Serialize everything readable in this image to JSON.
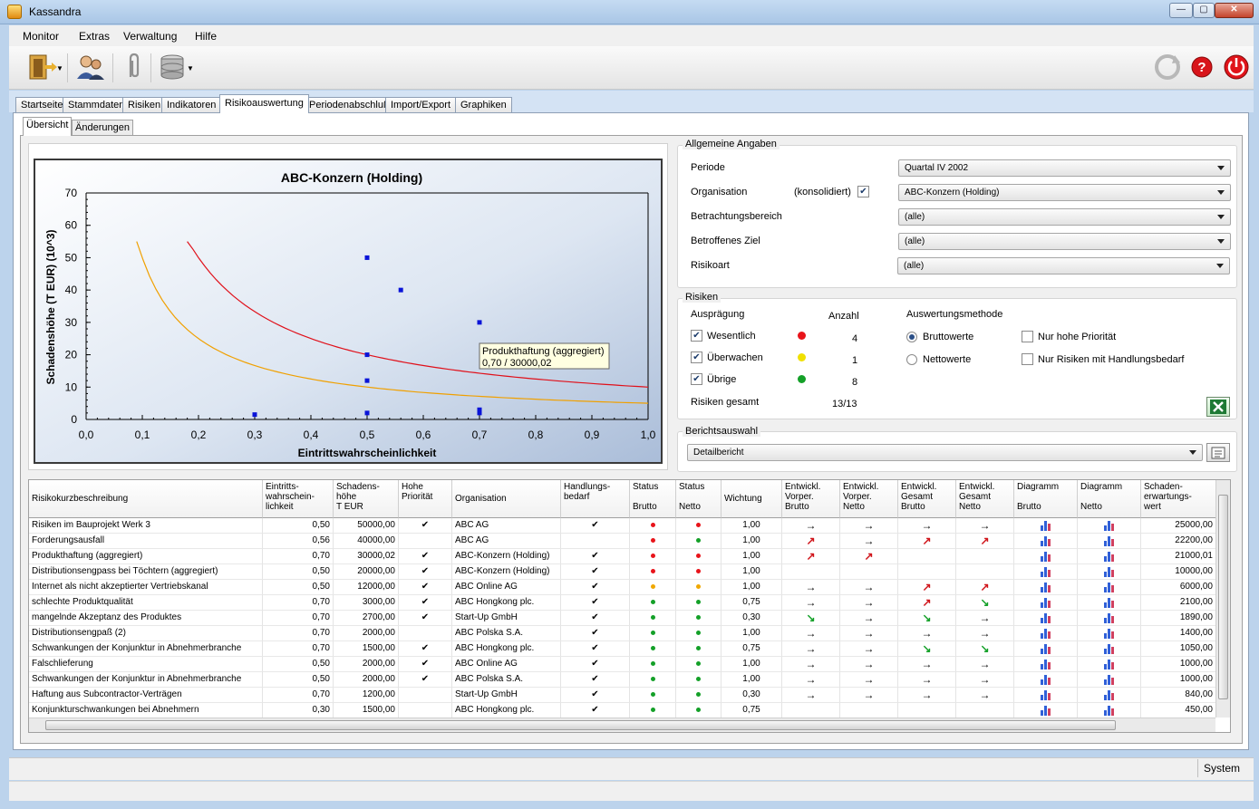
{
  "window": {
    "title": "Kassandra",
    "controls": [
      "—",
      "▢",
      "✕"
    ]
  },
  "menu": [
    "Monitor",
    "Extras",
    "Verwaltung",
    "Hilfe"
  ],
  "toolbar": {
    "left_icons": [
      "exit-door-icon",
      "users-icon",
      "paperclip-icon",
      "database-icon"
    ],
    "right_icons": [
      "refresh-icon",
      "help-icon",
      "power-icon"
    ]
  },
  "tabs": [
    "Startseite",
    "Stammdaten",
    "Risiken",
    "Indikatoren",
    "Risikoauswertung",
    "Periodenabschluß",
    "Import/Export",
    "Graphiken"
  ],
  "active_tab": "Risikoauswertung",
  "subtabs": [
    "Übersicht",
    "Änderungen"
  ],
  "active_subtab": "Übersicht",
  "chart_data": {
    "type": "scatter",
    "title": "ABC-Konzern (Holding)",
    "xlabel": "Eintrittswahrscheinlichkeit",
    "ylabel": "Schadenshöhe (T EUR)   (10^3)",
    "xlim": [
      0.0,
      1.0
    ],
    "ylim": [
      0,
      70
    ],
    "xticks": [
      "0,0",
      "0,1",
      "0,2",
      "0,3",
      "0,4",
      "0,5",
      "0,6",
      "0,7",
      "0,8",
      "0,9",
      "1,0"
    ],
    "yticks": [
      "0",
      "10",
      "20",
      "30",
      "40",
      "50",
      "60",
      "70"
    ],
    "points": [
      [
        0.5,
        50
      ],
      [
        0.56,
        40
      ],
      [
        0.7,
        30
      ],
      [
        0.5,
        20
      ],
      [
        0.5,
        12
      ],
      [
        0.3,
        1.5
      ],
      [
        0.5,
        2
      ],
      [
        0.7,
        3
      ],
      [
        0.7,
        2.7
      ],
      [
        0.7,
        2
      ]
    ],
    "curves": [
      {
        "color": "#e0101a",
        "k": 10,
        "x": [
          0.18,
          1.0
        ]
      },
      {
        "color": "#f0a000",
        "k": 5,
        "x": [
          0.09,
          1.0
        ]
      }
    ],
    "tooltip": {
      "line1": "Produkthaftung (aggregiert)",
      "line2": "0,70 / 30000,02"
    },
    "grid": false
  },
  "allgemein": {
    "title": "Allgemeine Angaben",
    "periode_label": "Periode",
    "periode_value": "Quartal IV 2002",
    "organisation_label": "Organisation",
    "konsolidiert_label": "(konsolidiert)",
    "organisation_value": "ABC-Konzern (Holding)",
    "betrachtung_label": "Betrachtungsbereich",
    "betrachtung_value": "(alle)",
    "ziel_label": "Betroffenes Ziel",
    "ziel_value": "(alle)",
    "risikoart_label": "Risikoart",
    "risikoart_value": "(alle)"
  },
  "risiken": {
    "title": "Risiken",
    "auspraegung": "Ausprägung",
    "anzahl": "Anzahl",
    "methode": "Auswertungsmethode",
    "wesentlich": "Wesentlich",
    "wesentlich_n": "4",
    "ueberwachen": "Überwachen",
    "ueberwachen_n": "1",
    "uebrige": "Übrige",
    "uebrige_n": "8",
    "gesamt_label": "Risiken gesamt",
    "gesamt_value": "13/13",
    "brutto": "Bruttowerte",
    "netto": "Nettowerte",
    "hohe_prio": "Nur hohe Priorität",
    "handlungsbedarf": "Nur Risiken mit Handlungsbedarf",
    "colors": {
      "wesentlich": "#e8141a",
      "ueberwachen": "#f0e000",
      "uebrige": "#14a028"
    }
  },
  "bericht": {
    "title": "Berichtsauswahl",
    "value": "Detailbericht"
  },
  "table": {
    "headers": [
      "Risikokurzbeschreibung",
      "Eintritts-\nwahrschein-\nlichkeit",
      "Schadens-\nhöhe\nT  EUR",
      "Hohe\nPriorität",
      "Organisation",
      "Handlungs-\nbedarf",
      "Status\n\nBrutto",
      "Status\n\nNetto",
      "Wichtung",
      "Entwickl.\nVorper.\nBrutto",
      "Entwickl.\nVorper.\nNetto",
      "Entwickl.\nGesamt\nBrutto",
      "Entwickl.\nGesamt\nNetto",
      "Diagramm\n\nBrutto",
      "Diagramm\n\nNetto",
      "Schaden-\nerwartungs-\nwert"
    ],
    "rows": [
      [
        "Risiken im Bauprojekt Werk 3",
        "0,50",
        "50000,00",
        "✔",
        "ABC AG",
        "✔",
        "r",
        "r",
        "1,00",
        "→",
        "→",
        "→",
        "→",
        "25000,00"
      ],
      [
        "Forderungsausfall",
        "0,56",
        "40000,00",
        "",
        "ABC AG",
        "",
        "r",
        "g",
        "1,00",
        "↗",
        "→",
        "↗",
        "↗",
        "22200,00"
      ],
      [
        "Produkthaftung (aggregiert)",
        "0,70",
        "30000,02",
        "✔",
        "ABC-Konzern (Holding)",
        "✔",
        "r",
        "r",
        "1,00",
        "↗",
        "↗",
        "",
        "",
        "21000,01"
      ],
      [
        "Distributionsengpass bei Töchtern (aggregiert)",
        "0,50",
        "20000,00",
        "✔",
        "ABC-Konzern (Holding)",
        "✔",
        "r",
        "r",
        "1,00",
        "",
        "",
        "",
        "",
        "10000,00"
      ],
      [
        "Internet als  nicht akzeptierter Vertriebskanal",
        "0,50",
        "12000,00",
        "✔",
        "ABC Online AG",
        "✔",
        "o",
        "o",
        "1,00",
        "→",
        "→",
        "↗",
        "↗",
        "6000,00"
      ],
      [
        "schlechte Produktqualität",
        "0,70",
        "3000,00",
        "✔",
        "ABC Hongkong plc.",
        "✔",
        "g",
        "g",
        "0,75",
        "→",
        "→",
        "↗",
        "↘",
        "2100,00"
      ],
      [
        "mangelnde Akzeptanz des Produktes",
        "0,70",
        "2700,00",
        "✔",
        "Start-Up GmbH",
        "✔",
        "g",
        "g",
        "0,30",
        "↘",
        "→",
        "↘",
        "→",
        "1890,00"
      ],
      [
        "Distributionsengpaß (2)",
        "0,70",
        "2000,00",
        "",
        "ABC Polska S.A.",
        "✔",
        "g",
        "g",
        "1,00",
        "→",
        "→",
        "→",
        "→",
        "1400,00"
      ],
      [
        "Schwankungen der Konjunktur in Abnehmerbranche",
        "0,70",
        "1500,00",
        "✔",
        "ABC Hongkong plc.",
        "✔",
        "g",
        "g",
        "0,75",
        "→",
        "→",
        "↘",
        "↘",
        "1050,00"
      ],
      [
        "Falschlieferung",
        "0,50",
        "2000,00",
        "✔",
        "ABC Online AG",
        "✔",
        "g",
        "g",
        "1,00",
        "→",
        "→",
        "→",
        "→",
        "1000,00"
      ],
      [
        "Schwankungen der Konjunktur in Abnehmerbranche",
        "0,50",
        "2000,00",
        "✔",
        "ABC Polska S.A.",
        "✔",
        "g",
        "g",
        "1,00",
        "→",
        "→",
        "→",
        "→",
        "1000,00"
      ],
      [
        "Haftung aus Subcontractor-Verträgen",
        "0,70",
        "1200,00",
        "",
        "Start-Up GmbH",
        "✔",
        "g",
        "g",
        "0,30",
        "→",
        "→",
        "→",
        "→",
        "840,00"
      ],
      [
        "Konjunkturschwankungen bei Abnehmern",
        "0,30",
        "1500,00",
        "",
        "ABC Hongkong plc.",
        "✔",
        "g",
        "g",
        "0,75",
        "",
        "",
        "",
        "",
        "450,00"
      ]
    ]
  },
  "status": {
    "user": "System"
  }
}
